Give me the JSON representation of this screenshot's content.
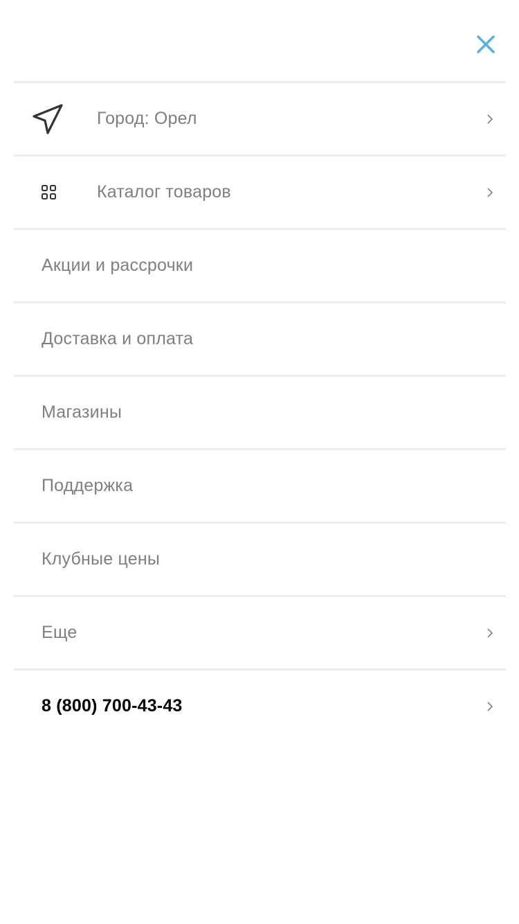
{
  "header": {
    "close_icon": "close-icon",
    "close_color": "#5aaee0"
  },
  "menu": {
    "city": {
      "label": "Город: Орел"
    },
    "catalog": {
      "label": "Каталог товаров"
    },
    "items": [
      {
        "label": "Акции и рассрочки"
      },
      {
        "label": "Доставка и оплата"
      },
      {
        "label": "Магазины"
      },
      {
        "label": "Поддержка"
      },
      {
        "label": "Клубные цены"
      }
    ],
    "more": {
      "label": "Еще"
    },
    "phone": {
      "label": "8 (800) 700-43-43"
    }
  }
}
